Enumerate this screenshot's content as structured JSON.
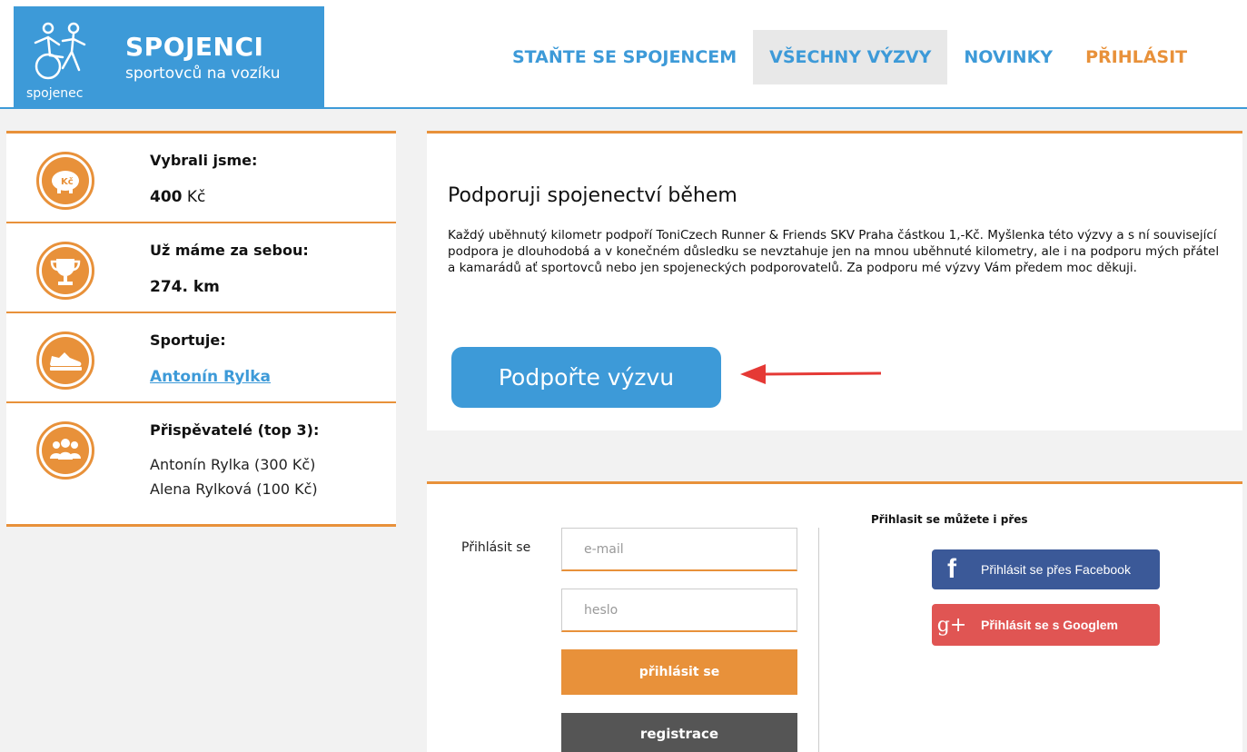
{
  "logo": {
    "title": "SPOJENCI",
    "subtitle": "sportovců na vozíku",
    "icon_text": "spojenec"
  },
  "nav": {
    "items": [
      {
        "label": "STAŇTE SE SPOJENCEM",
        "active": false
      },
      {
        "label": "VŠECHNY VÝZVY",
        "active": true
      },
      {
        "label": "NOVINKY",
        "active": false
      },
      {
        "label": "PŘIHLÁSIT",
        "active": false
      }
    ]
  },
  "sidebar": {
    "raised": {
      "label": "Vybrali jsme:",
      "amount": "400",
      "currency": "Kč",
      "icon": "piggy-bank-icon",
      "icon_text": "Kč"
    },
    "distance": {
      "label": "Už máme za sebou:",
      "value": "274. km",
      "icon": "trophy-icon"
    },
    "athlete": {
      "label": "Sportuje:",
      "name": "Antonín Rylka",
      "icon": "sneaker-icon"
    },
    "contributors": {
      "label": "Přispěvatelé (top 3):",
      "icon": "people-icon",
      "items": [
        "Antonín Rylka (300 Kč)",
        "Alena Rylková (100 Kč)"
      ]
    }
  },
  "challenge": {
    "title": "Podporuji spojenectví během",
    "description": "Každý uběhnutý kilometr podpoří ToniCzech Runner & Friends SKV Praha částkou 1,-Kč. Myšlenka této výzvy a s ní související podpora je dlouhodobá a v konečném důsledku se nevztahuje jen na mnou uběhnuté kilometry, ale i na podporu mých přátel a kamarádů ať sportovců nebo jen spojeneckých podporovatelů. Za podporu mé výzvy Vám předem moc děkuji.",
    "support_button": "Podpořte výzvu"
  },
  "login": {
    "label": "Přihlásit se",
    "email_placeholder": "e-mail",
    "password_placeholder": "heslo",
    "login_button": "přihlásit se",
    "register_button": "registrace",
    "social_title": "Přihlasit se můžete i přes",
    "facebook_button": "Přihlásit se přes Facebook",
    "facebook_icon_text": "f",
    "google_button": "Přihlásit se s Googlem",
    "google_icon_text": "g+"
  },
  "colors": {
    "brand_blue": "#3d9ad8",
    "accent_orange": "#e8913a",
    "facebook": "#3b5998",
    "google": "#e05553",
    "arrow": "#e53935"
  }
}
